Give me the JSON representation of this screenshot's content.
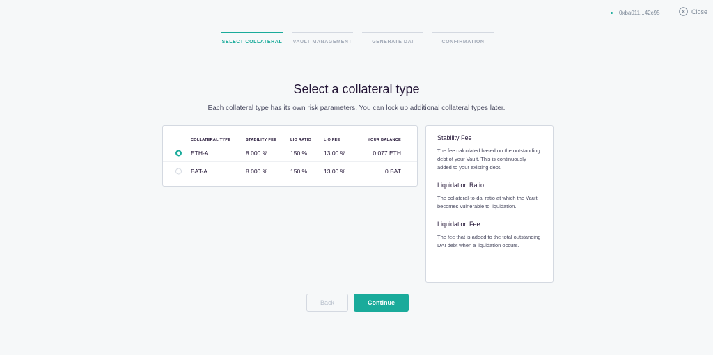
{
  "header": {
    "account": "0xba011...42c95",
    "close_label": "Close"
  },
  "steps": [
    {
      "label": "SELECT COLLATERAL",
      "active": true
    },
    {
      "label": "VAULT MANAGEMENT",
      "active": false
    },
    {
      "label": "GENERATE DAI",
      "active": false
    },
    {
      "label": "CONFIRMATION",
      "active": false
    }
  ],
  "main": {
    "title": "Select a collateral type",
    "subtitle": "Each collateral type has its own risk parameters. You can lock up additional collateral types later."
  },
  "table": {
    "headers": {
      "type": "COLLATERAL TYPE",
      "fee": "STABILITY FEE",
      "ratio": "LIQ RATIO",
      "liq_fee": "LIQ FEE",
      "balance": "YOUR BALANCE"
    },
    "rows": [
      {
        "type": "ETH-A",
        "fee": "8.000 %",
        "ratio": "150 %",
        "liq_fee": "13.00 %",
        "balance": "0.077 ETH",
        "selected": true
      },
      {
        "type": "BAT-A",
        "fee": "8.000 %",
        "ratio": "150 %",
        "liq_fee": "13.00 %",
        "balance": "0 BAT",
        "selected": false
      }
    ]
  },
  "info": [
    {
      "title": "Stability Fee",
      "text": "The fee calculated based on the outstanding debt of your Vault. This is continuously added to your existing debt."
    },
    {
      "title": "Liquidation Ratio",
      "text": "The collateral-to-dai ratio at which the Vault becomes vulnerable to liquidation."
    },
    {
      "title": "Liquidation Fee",
      "text": "The fee that is added to the total outstanding DAI debt when a liquidation occurs."
    }
  ],
  "buttons": {
    "back": "Back",
    "continue": "Continue"
  },
  "colors": {
    "accent": "#1aab9b",
    "text": "#231536",
    "muted": "#7e8a99",
    "border": "#d4d9e1"
  }
}
